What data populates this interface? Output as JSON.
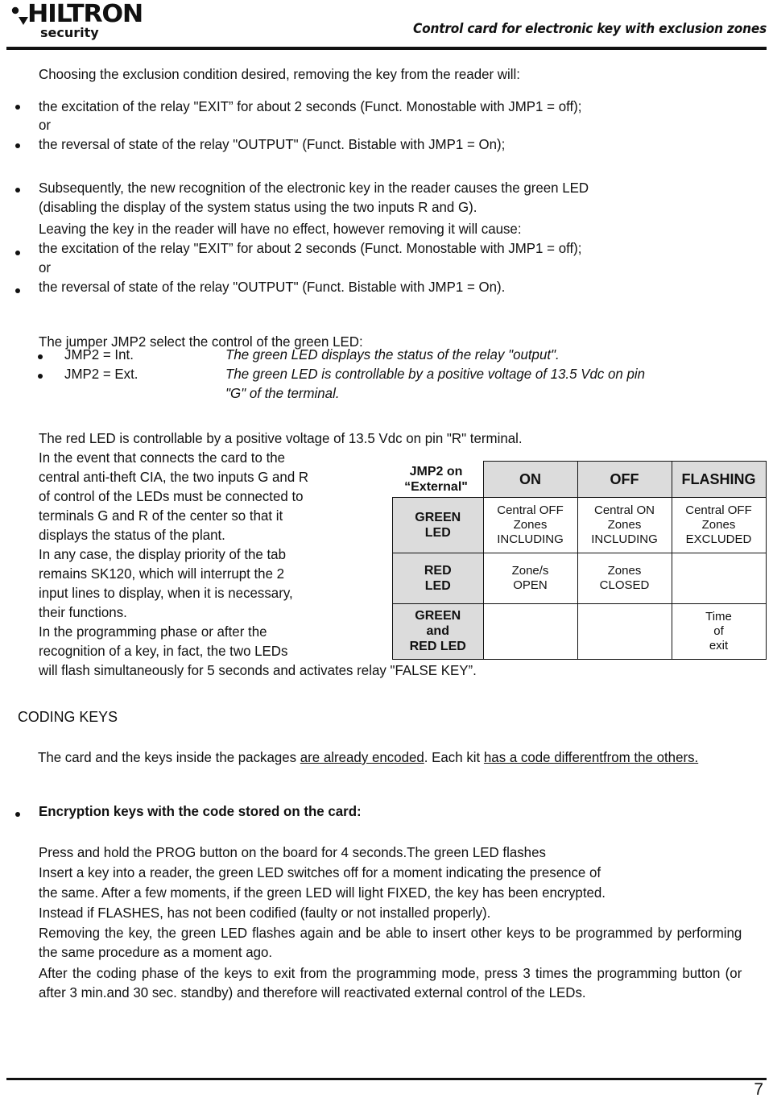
{
  "header": {
    "logo_word": "HILTRON",
    "logo_sub": "security",
    "title": "Control card for electronic key with exclusion zones"
  },
  "body": {
    "intro": "Choosing the exclusion condition desired, removing the key from the reader will:",
    "b1_line1": "the excitation of the relay \"EXIT” for about 2 seconds (Funct. Monostable with JMP1 = off);",
    "b1_line2": "or",
    "b2_line1": "the reversal of state of the relay \"OUTPUT\" (Funct. Bistable with JMP1 = On);",
    "b3_line1": "Subsequently, the new recognition of the electronic key in the reader causes the green LED",
    "b3_line2": "(disabling the display of the system status using the two inputs R and G).",
    "b4_line0": "Leaving the key in the reader will have no effect, however removing it will cause:",
    "b4_line1": "the excitation of the relay \"EXIT” for about 2 seconds (Funct. Monostable with JMP1 = off);",
    "b4_line2": "or",
    "b5_line1": "the reversal of state of the relay \"OUTPUT\" (Funct. Bistable with JMP1 = On).",
    "jmp2_intro": "The jumper JMP2 select the control of the green LED:",
    "jmp2_int_label": "JMP2 = Int.",
    "jmp2_int_desc": "The green LED displays the status of the relay \"output\".",
    "jmp2_ext_label": "JMP2 = Ext.",
    "jmp2_ext_desc1": "The green LED is controllable by a positive voltage of 13.5 Vdc on pin",
    "jmp2_ext_desc2": "\"G\" of the terminal.",
    "red_led_line": "The red LED is controllable by a positive voltage of 13.5 Vdc on pin \"R\" terminal.",
    "left_para_lines": [
      "In the event that connects the card to the",
      "central anti-theft CIA, the two inputs G and R",
      " of control of the LEDs must be connected to",
      "terminals G and R of the center so that it",
      "displays the status of the plant.",
      "In any case, the display priority of the tab",
      "remains SK120, which will interrupt the 2",
      "input lines to display, when it is necessary,",
      "their functions.",
      "In the programming phase or after the",
      "recognition of a key, in fact, the two LEDs"
    ],
    "full_width_line": "will flash simultaneously for 5 seconds and activates relay \"FALSE KEY”.",
    "coding_keys_heading": "CODING KEYS",
    "coding_p_a": "The card and the keys inside the packages ",
    "coding_p_b": "are already encoded",
    "coding_p_c": ". Each kit ",
    "coding_p_d": "has a code different",
    "coding_p_e": "from the others.",
    "encryption_heading": "Encryption keys with the code stored on the card:",
    "enc_line1": "Press and hold the PROG button on the board for 4 seconds.The green LED flashes",
    "enc_line2": "Insert a key into a reader, the green LED switches off for a moment indicating the presence of",
    "enc_line3": "the same. After a few moments, if the green LED will light FIXED, the key has been encrypted.",
    "enc_line4": "Instead if FLASHES, has not been codified (faulty or not installed properly).",
    "enc_para2": "Removing the key, the green LED flashes again and be able to insert other keys to be programmed by performing the same procedure as a moment ago.",
    "enc_para3": "After the coding phase of the keys to exit from the programming mode, press 3 times the programming button (or after 3 min.and 30 sec. standby) and therefore will reactivated external control of the LEDs."
  },
  "table": {
    "corner_line1": "JMP2 on",
    "corner_line2": "“External\"",
    "columns": [
      "ON",
      "OFF",
      "FLASHING"
    ],
    "rows": [
      {
        "header": "GREEN\nLED",
        "header_line1": "GREEN",
        "header_line2": "LED",
        "cells": [
          "Central OFF\nZones\nINCLUDING",
          "Central ON\nZones\nINCLUDING",
          "Central OFF\nZones\nEXCLUDED"
        ]
      },
      {
        "header_line1": "RED",
        "header_line2": "LED",
        "cells": [
          "Zone/s\nOPEN",
          "Zones\nCLOSED",
          ""
        ]
      },
      {
        "header_line1": "GREEN",
        "header_line2": "and",
        "header_line3": "RED LED",
        "cells": [
          "",
          "",
          "Time\nof\nexit"
        ]
      }
    ]
  },
  "footer": {
    "page_number": "7"
  },
  "colors": {
    "ink": "#111111",
    "table_header_bg": "#dcdcdc",
    "page_bg": "#ffffff"
  }
}
